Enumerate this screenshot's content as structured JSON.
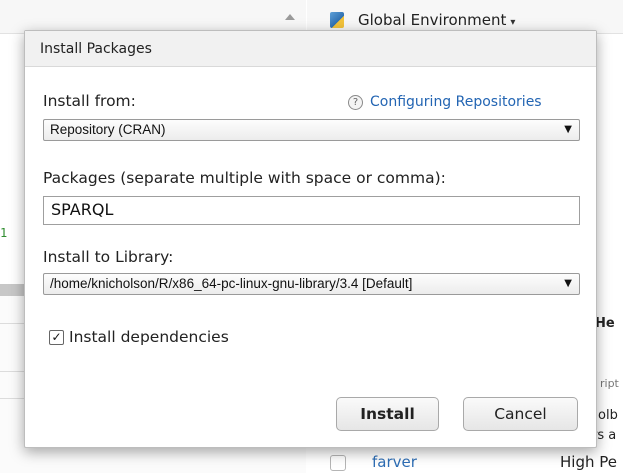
{
  "background": {
    "console_number": "1",
    "environment_label": "Global Environment",
    "packages_header": "He",
    "description_fragment": "ript",
    "text_fragment_1": "olb",
    "text_fragment_2": "rs a",
    "package_row": {
      "name": "farver",
      "title": "High Pe"
    }
  },
  "dialog": {
    "title": "Install Packages",
    "install_from_label": "Install from:",
    "help_link": "Configuring Repositories",
    "install_from_value": "Repository (CRAN)",
    "packages_label": "Packages (separate multiple with space or comma):",
    "packages_value": "SPARQL",
    "library_label": "Install to Library:",
    "library_value": "/home/knicholson/R/x86_64-pc-linux-gnu-library/3.4 [Default]",
    "dependencies_label": "Install dependencies",
    "dependencies_checked": true,
    "install_button": "Install",
    "cancel_button": "Cancel"
  }
}
